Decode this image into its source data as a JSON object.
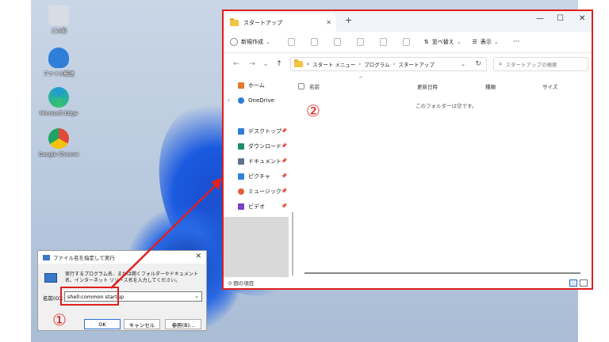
{
  "desktop": {
    "icons": [
      {
        "label": "ごみ箱",
        "color": "#d8dce3"
      },
      {
        "label": "ファイル転送",
        "color": "#2f7fd8"
      },
      {
        "label": "Microsoft Edge",
        "color": "#1e9ad6"
      },
      {
        "label": "Google Chrome",
        "color": "#e04a3a"
      }
    ]
  },
  "explorer": {
    "tab_title": "スタートアップ",
    "new_tab": "+",
    "window_controls": {
      "minimize": "—",
      "maximize": "☐",
      "close": "✕"
    },
    "toolbar": {
      "new_label": "新規作成",
      "sort_label": "並べ替え",
      "view_label": "表示",
      "more_label": "···"
    },
    "address": {
      "prefix": "«",
      "crumbs": [
        "スタート メニュー",
        "プログラム",
        "スタートアップ"
      ],
      "search_placeholder": "スタートアップの検索"
    },
    "sidebar": {
      "home": "ホーム",
      "onedrive": "OneDrive",
      "quick": [
        {
          "label": "デスクトップ",
          "color": "#2e7bd6"
        },
        {
          "label": "ダウンロード",
          "color": "#1e8f6e"
        },
        {
          "label": "ドキュメント",
          "color": "#5f7391"
        },
        {
          "label": "ピクチャ",
          "color": "#2e84d9"
        },
        {
          "label": "ミュージック",
          "color": "#e0623a"
        },
        {
          "label": "ビデオ",
          "color": "#7b3fc9"
        }
      ]
    },
    "columns": [
      "名前",
      "更新日時",
      "種類",
      "サイズ"
    ],
    "empty_message": "このフォルダーは空です。",
    "status": "0 個の項目"
  },
  "run_dialog": {
    "title": "ファイル名を指定して実行",
    "description": "実行するプログラム名、または開くフォルダーやドキュメント名、インターネット リソース名を入力してください。",
    "open_label": "名前(O):",
    "input_value": "shell:common startup",
    "ok": "OK",
    "cancel": "キャンセル",
    "browse": "参照(B)..."
  },
  "annotations": {
    "step1": "①",
    "step2": "②",
    "color": "#e0201f"
  }
}
